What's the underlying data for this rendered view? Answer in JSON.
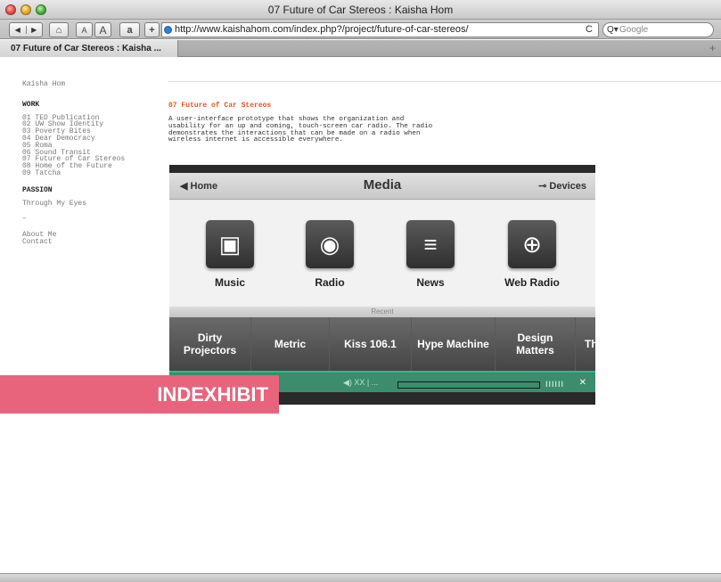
{
  "window": {
    "title": "07 Future of Car Stereos : Kaisha Hom"
  },
  "toolbar": {
    "back_glyph": "◀",
    "forward_glyph": "▶",
    "home_glyph": "⌂",
    "font_small": "A",
    "font_large": "A",
    "amazon_glyph": "a",
    "add_glyph": "+",
    "url": "http://www.kaishahom.com/index.php?/project/future-of-car-stereos/",
    "reload_glyph": "C",
    "search_placeholder": "Google",
    "search_glyph": "Q▾"
  },
  "tabs": {
    "active_label": "07 Future of Car Stereos : Kaisha ...",
    "new_tab_glyph": "+"
  },
  "sidebar": {
    "site_name": "Kaisha Hom",
    "work_heading": "WORK",
    "work_items": [
      "01 TED Publication",
      "02 UW Show Identity",
      "03 Poverty Bites",
      "04 Dear Democracy",
      "05 Roma",
      "06 Sound Transit",
      "07 Future of Car Stereos",
      "08 Home of the Future",
      "09 Tatcha"
    ],
    "passion_heading": "PASSION",
    "passion_items": [
      "Through My Eyes"
    ],
    "separator": "–",
    "other_items": [
      "About Me",
      "Contact"
    ]
  },
  "project": {
    "title": "07 Future of Car Stereos",
    "description": "A user-interface prototype that shows the organization and usability for an up and coming, touch-screen car radio. The radio demonstrates the interactions that can be made on a radio when wireless internet is accessible everywhere."
  },
  "screenshot": {
    "home_label": "◀ Home",
    "title": "Media",
    "devices_label": "Devices",
    "apps": [
      {
        "label": "Music",
        "icon": "ipod-icon",
        "glyph": "▣"
      },
      {
        "label": "Radio",
        "icon": "wifi-icon",
        "glyph": "◉"
      },
      {
        "label": "News",
        "icon": "document-icon",
        "glyph": "≡"
      },
      {
        "label": "Web Radio",
        "icon": "globe-icon",
        "glyph": "⊕"
      }
    ],
    "recent_label": "Recent",
    "recent_items": [
      [
        "Dirty",
        "Projectors"
      ],
      [
        "Metric"
      ],
      [
        "Kiss 106.1"
      ],
      [
        "Hype Machine"
      ],
      [
        "Design",
        "Matters"
      ],
      [
        "Th"
      ]
    ],
    "player_volume": "◀) XX | ..."
  },
  "badge": {
    "text": "INDEXHIBIT"
  },
  "colors": {
    "accent": "#e8561c",
    "badge": "#e8637c",
    "player": "#2fb886"
  }
}
